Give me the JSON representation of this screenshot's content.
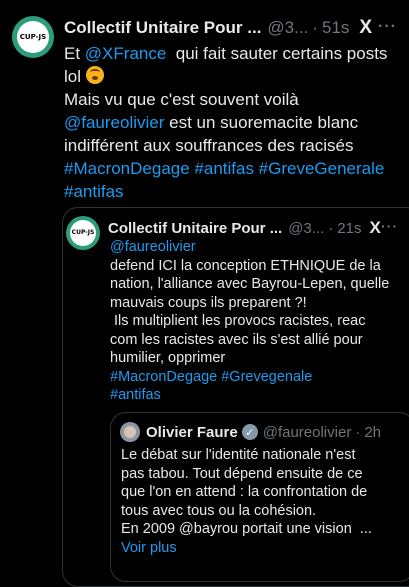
{
  "tweet": {
    "author_name": "Collectif Unitaire Pour ...",
    "handle": "@3...",
    "time": "51s",
    "avatar_text": "CUP-JS",
    "line1_pre": "Et ",
    "line1_mention": "@XFrance",
    "line1_post": "  qui fait sauter certains posts",
    "line2_text": "lol",
    "line3": "Mais vu que c'est souvent voilà",
    "line4_mention": "@faureolivier",
    "line4_post": " est un suoremacite blanc",
    "line5": "indifférent aux souffrances des racisés",
    "hashtags_line6": "#MacronDegage #antifas #GreveGenerale",
    "hashtags_line7": "#antifas"
  },
  "quoted": {
    "author_name": "Collectif Unitaire Pour ...",
    "handle": "@3...",
    "time": "21s",
    "avatar_text": "CUP-JS",
    "lines": [
      "@faureolivier",
      "defend ICI la conception ETHNIQUE de la",
      "nation, l'alliance avec Bayrou-Lepen, quelle",
      "mauvais coups ils preparent ?!",
      " Ils multiplient les provocs racistes, reac",
      "com les racistes avec ils s'est allié pour",
      "humilier, opprimer",
      "#MacronDegage #Grevegenale",
      "#antifas"
    ]
  },
  "nested": {
    "author_name": "Olivier Faure",
    "handle": "@faureolivier",
    "time": "2h",
    "lines": [
      "Le débat sur l'identité nationale n'est",
      "pas tabou. Tout dépend ensuite de ce",
      "que l'on en attend : la confrontation de",
      "tous avec tous ou la cohésion.",
      "En 2009 @bayrou portait une vision  ..."
    ],
    "show_more": "Voir plus"
  },
  "ui": {
    "separator": "·",
    "more": "···",
    "x_logo": "X"
  }
}
